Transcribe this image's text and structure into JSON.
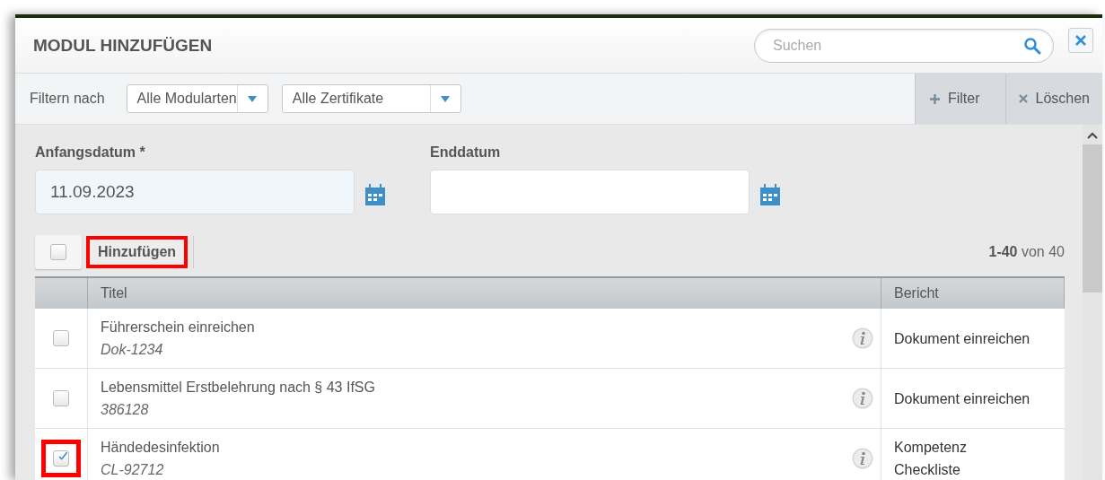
{
  "dialog": {
    "title": "MODUL HINZUFÜGEN",
    "search": {
      "placeholder": "Suchen"
    }
  },
  "filter_bar": {
    "label": "Filtern nach",
    "dropdowns": [
      {
        "value": "Alle Modularten"
      },
      {
        "value": "Alle Zertifikate"
      }
    ],
    "actions": [
      {
        "kind": "add",
        "label": "Filter"
      },
      {
        "kind": "clear",
        "label": "Löschen"
      }
    ]
  },
  "dates": [
    {
      "label": "Anfangsdatum *",
      "value": "11.09.2023",
      "filled": true
    },
    {
      "label": "Enddatum",
      "filled": false
    }
  ],
  "toolbar": {
    "select_all_checked": false,
    "add_button": {
      "label": "Hinzufügen",
      "highlighted": true
    },
    "pagination": "**1-40** von 40"
  },
  "table": {
    "columns": [
      "Titel",
      "Bericht"
    ],
    "rows": [
      {
        "title": "Führerschein einreichen",
        "code": "Dok-1234",
        "report": "Dokument einreichen",
        "checked": false,
        "highlighted": false
      },
      {
        "title": "Lebensmittel Erstbelehrung nach § 43 IfSG",
        "code": "386128",
        "report": "Dokument einreichen",
        "checked": false,
        "highlighted": false
      },
      {
        "title": "Händedesinfektion",
        "code": "CL-92712",
        "report": "Kompetenz Checkliste",
        "checked": true,
        "highlighted": true
      }
    ]
  }
}
